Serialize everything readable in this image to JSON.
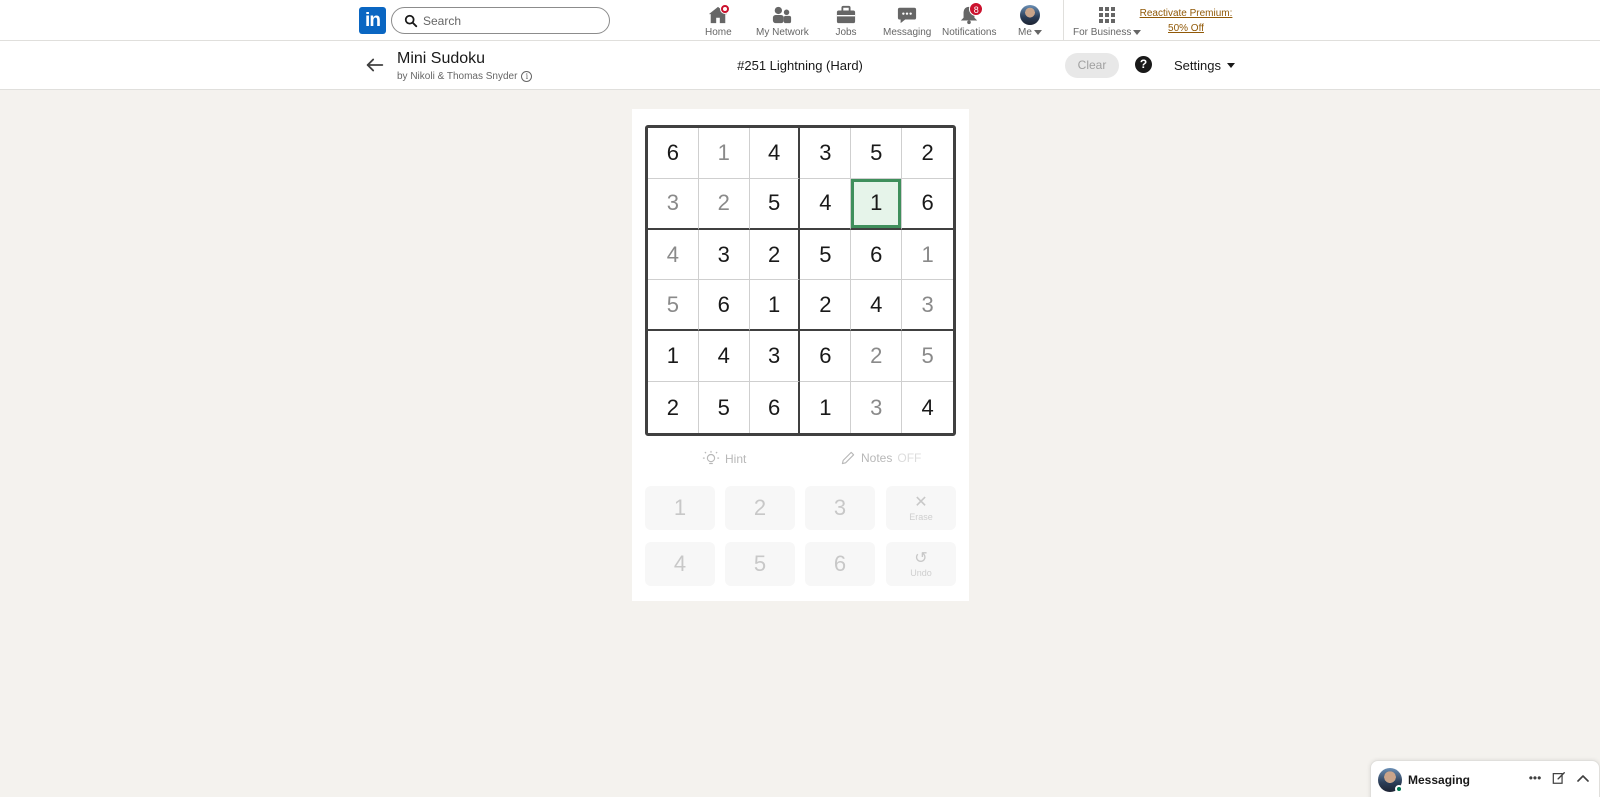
{
  "nav": {
    "logo_text": "in",
    "search": {
      "placeholder": "Search"
    },
    "items": [
      {
        "label": "Home",
        "badge": ""
      },
      {
        "label": "My Network",
        "badge": ""
      },
      {
        "label": "Jobs",
        "badge": ""
      },
      {
        "label": "Messaging",
        "badge": ""
      },
      {
        "label": "Notifications",
        "badge": "8"
      },
      {
        "label": "Me",
        "badge": ""
      },
      {
        "label": "For Business",
        "badge": ""
      }
    ],
    "premium": {
      "line1": "Reactivate Premium:",
      "line2": "50% Off"
    }
  },
  "game": {
    "title": "Mini Sudoku",
    "author": "by Nikoli & Thomas Snyder",
    "puzzle_id": "#251 Lightning (Hard)",
    "clear_label": "Clear",
    "help_label": "?",
    "settings_label": "Settings",
    "selected_cell": {
      "row": 1,
      "col": 4
    },
    "board": [
      [
        {
          "v": "6",
          "given": true
        },
        {
          "v": "1",
          "given": false
        },
        {
          "v": "4",
          "given": true
        },
        {
          "v": "3",
          "given": true
        },
        {
          "v": "5",
          "given": true
        },
        {
          "v": "2",
          "given": true
        }
      ],
      [
        {
          "v": "3",
          "given": false
        },
        {
          "v": "2",
          "given": false
        },
        {
          "v": "5",
          "given": true
        },
        {
          "v": "4",
          "given": true
        },
        {
          "v": "1",
          "given": true
        },
        {
          "v": "6",
          "given": true
        }
      ],
      [
        {
          "v": "4",
          "given": false
        },
        {
          "v": "3",
          "given": true
        },
        {
          "v": "2",
          "given": true
        },
        {
          "v": "5",
          "given": true
        },
        {
          "v": "6",
          "given": true
        },
        {
          "v": "1",
          "given": false
        }
      ],
      [
        {
          "v": "5",
          "given": false
        },
        {
          "v": "6",
          "given": true
        },
        {
          "v": "1",
          "given": true
        },
        {
          "v": "2",
          "given": true
        },
        {
          "v": "4",
          "given": true
        },
        {
          "v": "3",
          "given": false
        }
      ],
      [
        {
          "v": "1",
          "given": true
        },
        {
          "v": "4",
          "given": true
        },
        {
          "v": "3",
          "given": true
        },
        {
          "v": "6",
          "given": true
        },
        {
          "v": "2",
          "given": false
        },
        {
          "v": "5",
          "given": false
        }
      ],
      [
        {
          "v": "2",
          "given": true
        },
        {
          "v": "5",
          "given": true
        },
        {
          "v": "6",
          "given": true
        },
        {
          "v": "1",
          "given": true
        },
        {
          "v": "3",
          "given": false
        },
        {
          "v": "4",
          "given": true
        }
      ]
    ],
    "tools": {
      "hint_label": "Hint",
      "notes_label": "Notes",
      "notes_state": "OFF"
    },
    "keypad": {
      "numbers": [
        "1",
        "2",
        "3",
        "4",
        "5",
        "6"
      ],
      "erase_label": "Erase",
      "undo_label": "Undo"
    }
  },
  "messaging_dock": {
    "label": "Messaging"
  },
  "colors": {
    "brand": "#0a66c2",
    "selected_border": "#3f8f5c",
    "badge": "#cb112d",
    "premium": "#915907"
  }
}
